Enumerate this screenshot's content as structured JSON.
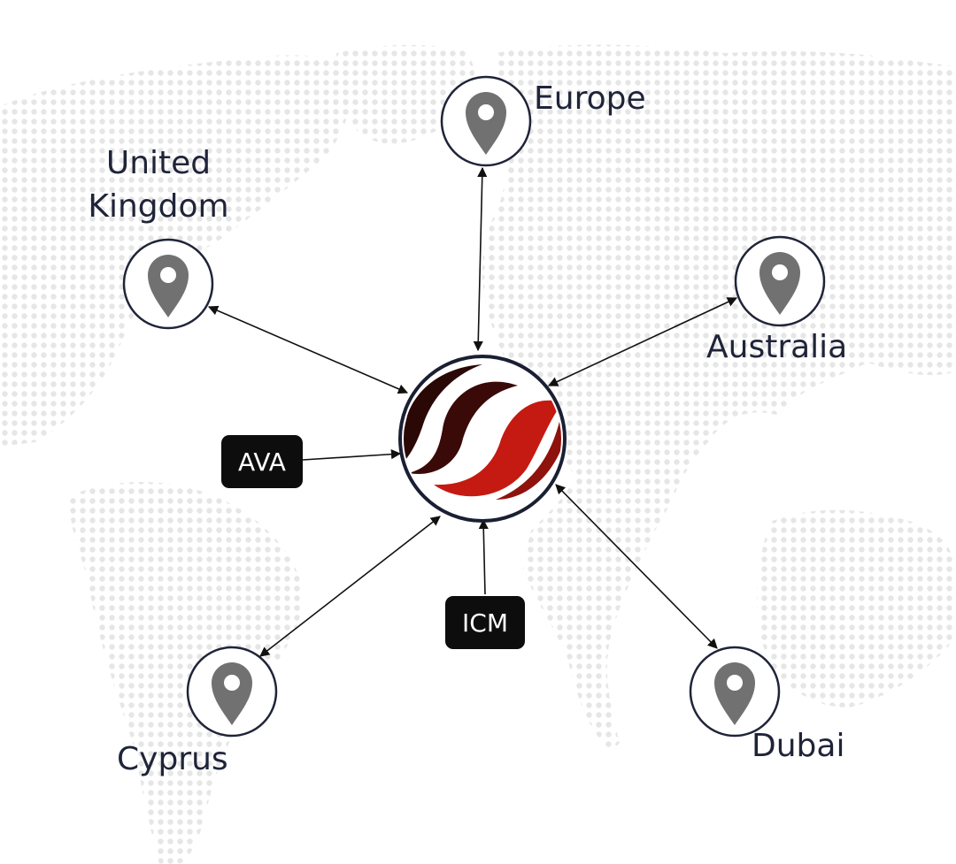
{
  "diagram": {
    "hub": {
      "name": "logo",
      "icon": "swoosh-logo"
    },
    "locations": [
      {
        "id": "europe",
        "label": "Europe",
        "icon": "location-pin-icon"
      },
      {
        "id": "united-kingdom",
        "label": "United\nKingdom",
        "icon": "location-pin-icon"
      },
      {
        "id": "australia",
        "label": "Australia",
        "icon": "location-pin-icon"
      },
      {
        "id": "cyprus",
        "label": "Cyprus",
        "icon": "location-pin-icon"
      },
      {
        "id": "dubai",
        "label": "Dubai",
        "icon": "location-pin-icon"
      }
    ],
    "sources": [
      {
        "id": "ava",
        "label": "AVA"
      },
      {
        "id": "icm",
        "label": "ICM"
      }
    ]
  },
  "colors": {
    "text": "#1f2438",
    "pin": "#717171",
    "map_dots": "#e6e6e6",
    "chip_bg": "#0d0d0d",
    "logo_dark": "#3a0a08",
    "logo_red": "#c41a12"
  }
}
